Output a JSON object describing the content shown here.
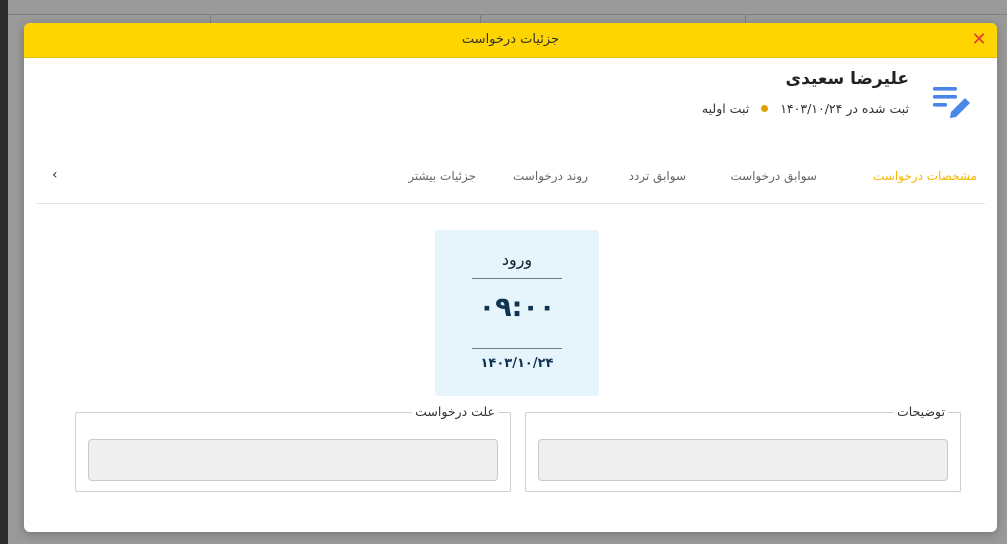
{
  "dialog": {
    "title": "جزئیات درخواست",
    "close_glyph": "✕"
  },
  "profile": {
    "name": "علیرضا سعیدی",
    "registered_text": "ثبت شده در ۱۴۰۳/۱۰/۲۴",
    "status": "ثبت اولیه",
    "status_color": "#e0a000",
    "icon": "edit-list-icon",
    "icon_color": "#4a86e8"
  },
  "tabs": [
    {
      "label": "مشخصات درخواست",
      "active": true
    },
    {
      "label": "سوابق درخواست",
      "active": false
    },
    {
      "label": "سوابق تردد",
      "active": false
    },
    {
      "label": "روند درخواست",
      "active": false
    },
    {
      "label": "جزئیات بیشتر",
      "active": false
    }
  ],
  "tab_scroll_glyph": "‹",
  "time_card": {
    "label": "ورود",
    "time": "۰۹:۰۰",
    "date": "۱۴۰۳/۱۰/۲۴"
  },
  "fields": {
    "description": {
      "label": "توضیحات",
      "value": ""
    },
    "reason": {
      "label": "علت درخواست",
      "value": ""
    }
  },
  "colors": {
    "header": "#ffd500",
    "accent": "#f5b800",
    "card_bg": "#e6f4fc"
  }
}
